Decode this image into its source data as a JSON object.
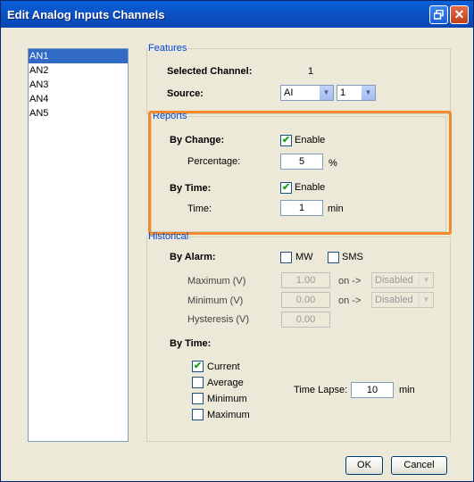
{
  "window": {
    "title": "Edit Analog Inputs Channels"
  },
  "channels": [
    "AN1",
    "AN2",
    "AN3",
    "AN4",
    "AN5"
  ],
  "features": {
    "legend": "Features",
    "selected_channel_label": "Selected Channel:",
    "selected_channel_value": "1",
    "source_label": "Source:",
    "source_type": "AI",
    "source_number": "1"
  },
  "reports": {
    "legend": "Reports",
    "by_change_label": "By Change:",
    "by_change_enable": "Enable",
    "percentage_label": "Percentage:",
    "percentage_value": "5",
    "percentage_unit": "%",
    "by_time_label": "By Time:",
    "by_time_enable": "Enable",
    "time_label": "Time:",
    "time_value": "1",
    "time_unit": "min"
  },
  "historical": {
    "legend": "Historical",
    "by_alarm_label": "By Alarm:",
    "mw_label": "MW",
    "sms_label": "SMS",
    "maximum_label": "Maximum (V)",
    "maximum_value": "1.00",
    "minimum_label": "Minimum (V)",
    "minimum_value": "0.00",
    "hysteresis_label": "Hysteresis (V)",
    "hysteresis_value": "0.00",
    "on_label": "on ->",
    "max_action": "Disabled",
    "min_action": "Disabled",
    "by_time_label": "By Time:",
    "current_label": "Current",
    "average_label": "Average",
    "minimum_cb_label": "Minimum",
    "maximum_cb_label": "Maximum",
    "time_lapse_label": "Time Lapse:",
    "time_lapse_value": "10",
    "time_lapse_unit": "min"
  },
  "buttons": {
    "ok": "OK",
    "cancel": "Cancel"
  },
  "colors": {
    "highlight": "#f4892b",
    "selection": "#316ac5",
    "legend": "#0046d5"
  }
}
